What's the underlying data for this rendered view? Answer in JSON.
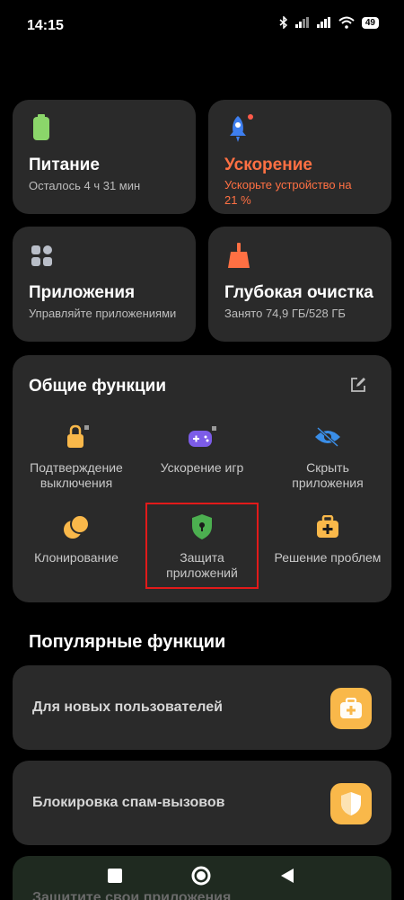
{
  "status": {
    "time": "14:15",
    "battery": "49"
  },
  "cards": {
    "power": {
      "title": "Питание",
      "subtitle": "Осталось 4 ч 31 мин"
    },
    "boost": {
      "title": "Ускорение",
      "subtitle_line1": "Ускорьте устройство на",
      "subtitle_line2": "21 %"
    },
    "apps": {
      "title": "Приложения",
      "subtitle": "Управляйте приложениями"
    },
    "deepclean": {
      "title": "Глубокая очистка",
      "subtitle": "Занято 74,9 ГБ/528 ГБ"
    }
  },
  "general": {
    "title": "Общие функции",
    "items": [
      {
        "line1": "Подтверждение",
        "line2": "выключения"
      },
      {
        "line1": "Ускорение игр",
        "line2": ""
      },
      {
        "line1": "Скрыть",
        "line2": "приложения"
      },
      {
        "line1": "Клонирование",
        "line2": ""
      },
      {
        "line1": "Защита",
        "line2": "приложений"
      },
      {
        "line1": "Решение проблем",
        "line2": ""
      }
    ]
  },
  "popular": {
    "title": "Популярные функции",
    "items": [
      {
        "label": "Для новых пользователей"
      },
      {
        "label": "Блокировка спам-вызовов"
      },
      {
        "label": "Защитите свои приложения"
      }
    ]
  },
  "colors": {
    "accent": "#ff7043",
    "card_bg": "#2a2a2a",
    "highlight": "#e21a1a",
    "icon_yellow": "#f9b84a"
  }
}
